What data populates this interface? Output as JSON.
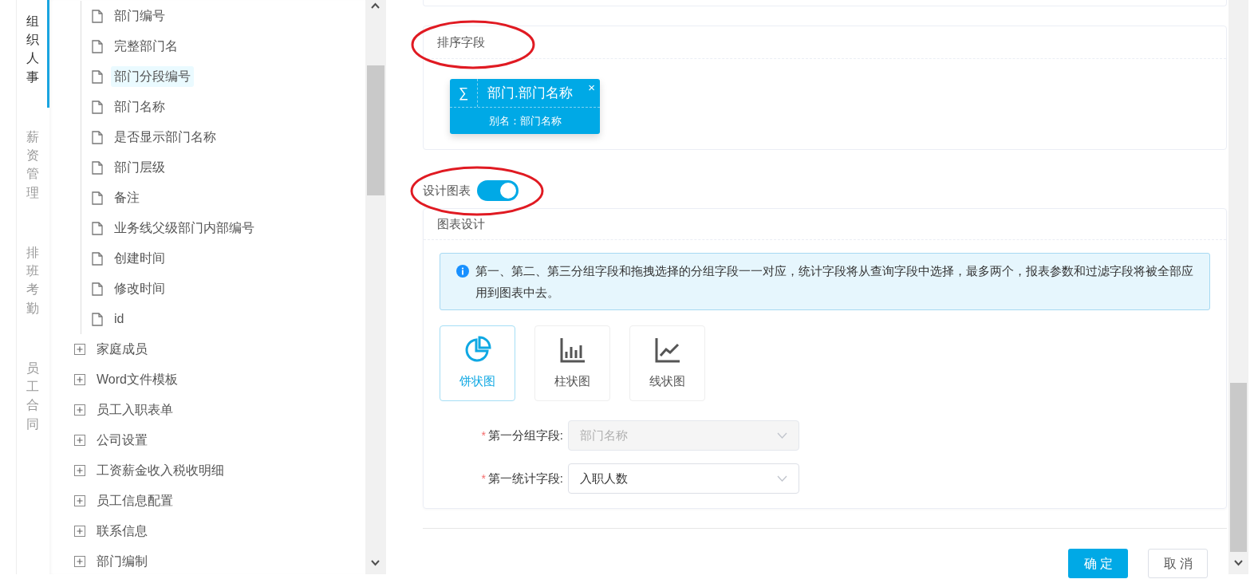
{
  "nav": [
    {
      "label": "组织人事",
      "selected": true
    },
    {
      "label": "薪资管理",
      "selected": false
    },
    {
      "label": "排班考勤",
      "selected": false
    },
    {
      "label": "员工合同",
      "selected": false
    }
  ],
  "tree": {
    "items": [
      {
        "expanded": true,
        "children": [
          {
            "label": "部门编号",
            "selected": false
          },
          {
            "label": "完整部门名",
            "selected": false
          },
          {
            "label": "部门分段编号",
            "selected": true
          },
          {
            "label": "部门名称",
            "selected": false
          },
          {
            "label": "是否显示部门名称",
            "selected": false
          },
          {
            "label": "部门层级",
            "selected": false
          },
          {
            "label": "备注",
            "selected": false
          },
          {
            "label": "业务线父级部门内部编号",
            "selected": false
          },
          {
            "label": "创建时间",
            "selected": false
          },
          {
            "label": "修改时间",
            "selected": false
          },
          {
            "label": "id",
            "selected": false
          }
        ]
      },
      {
        "label": "家庭成员",
        "expanded": false
      },
      {
        "label": "Word文件模板",
        "expanded": false
      },
      {
        "label": "员工入职表单",
        "expanded": false
      },
      {
        "label": "公司设置",
        "expanded": false
      },
      {
        "label": "工资薪金收入税收明细",
        "expanded": false
      },
      {
        "label": "员工信息配置",
        "expanded": false
      },
      {
        "label": "联系信息",
        "expanded": false
      },
      {
        "label": "部门编制",
        "expanded": false
      }
    ]
  },
  "sort_section": {
    "title": "排序字段",
    "annotated": true,
    "chips": [
      {
        "symbol": "∑",
        "field": "部门.部门名称",
        "close": "×",
        "alias": "别名：部门名称"
      }
    ]
  },
  "chart_toggle": {
    "label": "设计图表",
    "on": true,
    "annotated": true
  },
  "chart_design": {
    "title": "图表设计",
    "notice": "第一、第二、第三分组字段和拖拽选择的分组字段一一对应，统计字段将从查询字段中选择，最多两个，报表参数和过滤字段将被全部应用到图表中去。",
    "chart_types": [
      {
        "kind": "pie",
        "label": "饼状图",
        "selected": true
      },
      {
        "kind": "bar",
        "label": "柱状图",
        "selected": false
      },
      {
        "kind": "line",
        "label": "线状图",
        "selected": false
      }
    ],
    "fields": [
      {
        "required_mark": "*",
        "label": "第一分组字段:",
        "value": "部门名称",
        "disabled": true
      },
      {
        "required_mark": "*",
        "label": "第一统计字段:",
        "value": "入职人数",
        "disabled": false
      }
    ]
  },
  "buttons": [
    {
      "label": "确定",
      "kind": "primary"
    },
    {
      "label": "取消",
      "kind": "default"
    }
  ]
}
